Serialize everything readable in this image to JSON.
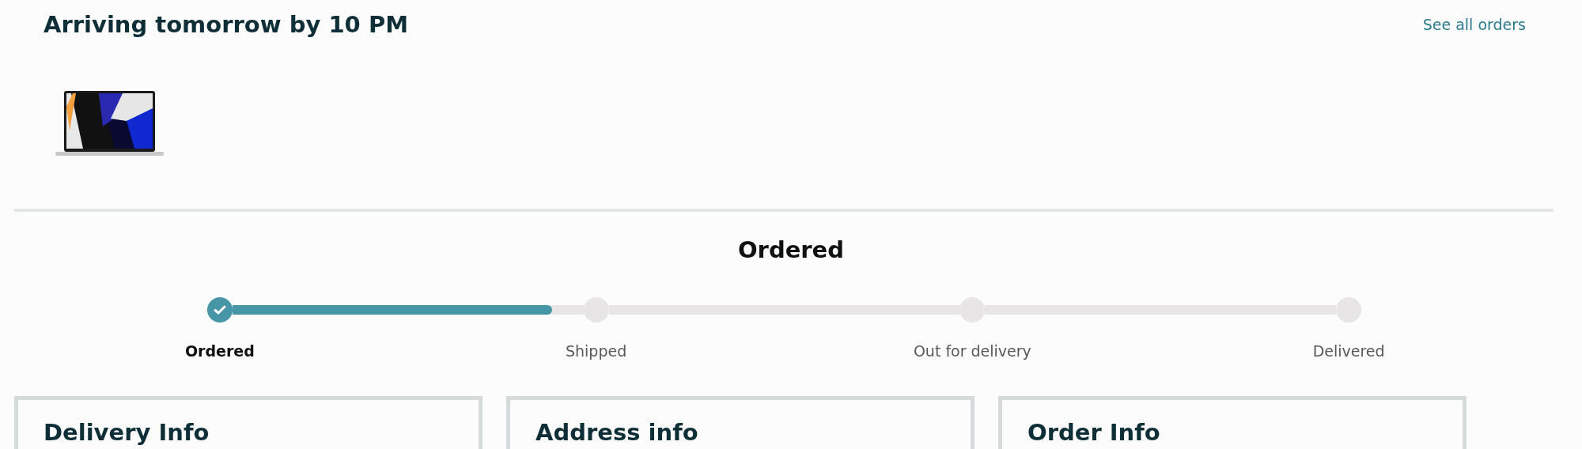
{
  "header": {
    "title": "Arriving tomorrow by 10 PM",
    "link": "See all orders"
  },
  "status": {
    "title": "Ordered"
  },
  "tracker": {
    "segments": [
      {
        "level": 0.91
      }
    ],
    "steps": [
      {
        "label": "Ordered",
        "completed": true,
        "selected": true
      },
      {
        "label": "Shipped",
        "completed": false,
        "selected": false
      },
      {
        "label": "Out for delivery",
        "completed": false,
        "selected": false
      },
      {
        "label": "Delivered",
        "completed": false,
        "selected": false
      }
    ]
  },
  "cards": [
    {
      "title": "Delivery Info"
    },
    {
      "title": "Address info"
    },
    {
      "title": "Order Info"
    }
  ]
}
